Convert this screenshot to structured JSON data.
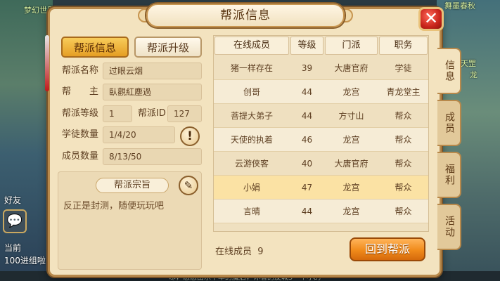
{
  "background": {
    "top_left_text": "梦幻世界",
    "top_right_text": "舞墨春秋",
    "left_labels": [
      "好友",
      "当前",
      "100进组啦"
    ],
    "right_labels": [
      "天罡",
      "龙"
    ],
    "bottom_ticker": "寒，恋恋由乐千年的魔后，你看的友城5一个小的"
  },
  "panel": {
    "title": "帮派信息",
    "close_label": "✕"
  },
  "tabs": {
    "info_label": "帮派信息",
    "upgrade_label": "帮派升级"
  },
  "guild": {
    "name_label": "帮派名称",
    "name_value": "过眼云烟",
    "leader_label": "帮　　主",
    "leader_value": "臥觀紅塵過",
    "level_label": "帮派等级",
    "level_value": "1",
    "id_label": "帮派ID",
    "id_value": "127",
    "apprentice_label": "学徒数量",
    "apprentice_value": "1/4/20",
    "member_label": "成员数量",
    "member_value": "8/13/50",
    "tip_icon": "!"
  },
  "purpose": {
    "title": "帮派宗旨",
    "text": "反正是封测，随便玩玩吧"
  },
  "table": {
    "headers": [
      "在线成员",
      "等级",
      "门派",
      "职务"
    ],
    "rows": [
      {
        "name": "猪一样存在",
        "level": "39",
        "sect": "大唐官府",
        "role": "学徒"
      },
      {
        "name": "创哥",
        "level": "44",
        "sect": "龙宫",
        "role": "青龙堂主"
      },
      {
        "name": "菩提大弟子",
        "level": "44",
        "sect": "方寸山",
        "role": "帮众"
      },
      {
        "name": "天使的执着",
        "level": "46",
        "sect": "龙宫",
        "role": "帮众"
      },
      {
        "name": "云游侠客",
        "level": "40",
        "sect": "大唐官府",
        "role": "帮众"
      },
      {
        "name": "小娟",
        "level": "47",
        "sect": "龙宫",
        "role": "帮众"
      },
      {
        "name": "言晴",
        "level": "44",
        "sect": "龙宫",
        "role": "帮众"
      }
    ]
  },
  "footer": {
    "online_label": "在线成员",
    "online_count": "9",
    "return_label": "回到帮派"
  },
  "side_tabs": [
    "信息",
    "成员",
    "福利",
    "活动"
  ],
  "colors": {
    "accent_orange": "#f08a1a",
    "panel_bg": "#f3e3bf",
    "close_red": "#c8241b"
  }
}
